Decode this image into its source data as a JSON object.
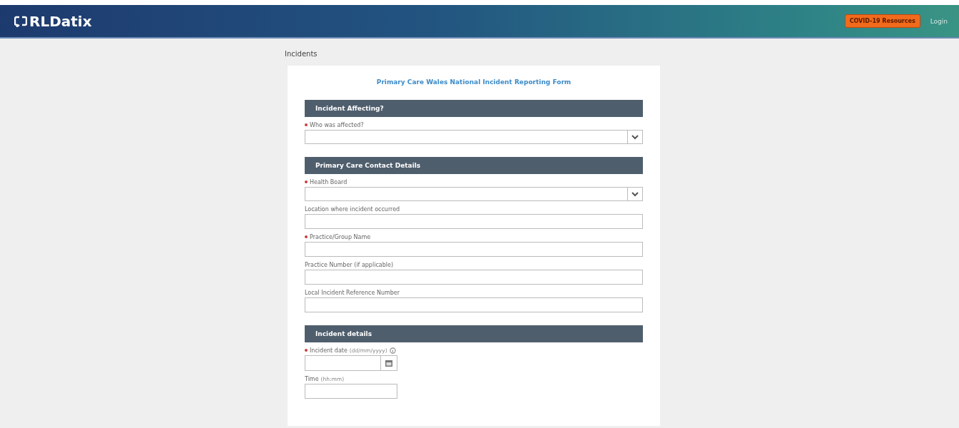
{
  "header": {
    "logo": "RLDatix",
    "covid_button": "COVID-19 Resources",
    "login": "Login"
  },
  "page_title": "Incidents",
  "form": {
    "title": "Primary Care Wales National Incident Reporting Form",
    "sections": [
      {
        "title": "Incident Affecting?",
        "fields": [
          {
            "label": "Who was affected?",
            "required": true,
            "kind": "select"
          }
        ]
      },
      {
        "title": "Primary Care Contact Details",
        "fields": [
          {
            "label": "Health Board",
            "required": true,
            "kind": "select"
          },
          {
            "label": "Location where incident occurred",
            "required": false,
            "kind": "text"
          },
          {
            "label": "Practice/Group Name",
            "required": true,
            "kind": "text"
          },
          {
            "label": "Practice Number (if applicable)",
            "required": false,
            "kind": "text"
          },
          {
            "label": "Local Incident Reference Number",
            "required": false,
            "kind": "text"
          }
        ]
      },
      {
        "title": "Incident details",
        "fields": [
          {
            "label": "Incident date",
            "hint": "(dd/mm/yyyy)",
            "required": true,
            "kind": "date"
          },
          {
            "label": "Time",
            "hint": "(hh:mm)",
            "required": false,
            "kind": "time"
          }
        ]
      }
    ]
  }
}
